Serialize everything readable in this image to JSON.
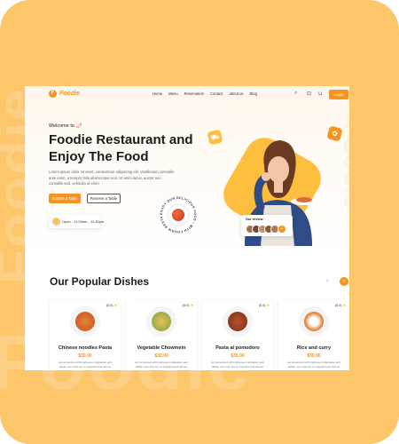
{
  "background": {
    "word_left": "Foodie",
    "word_bottom": "Foodie",
    "color": "#fdc66b"
  },
  "nav": {
    "logo": "Foodie",
    "links": [
      "Home",
      "Menu",
      "Reservation",
      "Contact",
      "about us",
      "Blog"
    ],
    "login_label": "Login",
    "accent": "#f7941d"
  },
  "hero": {
    "welcome": "Welcome to",
    "title": "Foodie Restaurant and Enjoy The Food",
    "description": "Lorem ipsum dolor sit amet, consectetur adipiscing elit. Vestibulum convallis ante enim, a tempor felis ullamcorper non. Ut enim lacus, auctor nec convallis sed, vehicula ut enim.",
    "btn_menu": "Explore a Table",
    "btn_reserve": "Reserve a Table",
    "hours": "Open : 11:00am - 11:30pm",
    "badge_text": "ENJOY OUR DELICIOUS FOOD • WITH FOODIE RESTAURANT •",
    "review_title": "Our review",
    "review_more": "+",
    "side_word": "Foodie"
  },
  "popular": {
    "title": "Our Popular Dishes",
    "prev": "‹",
    "next": "›",
    "dishes": [
      {
        "name": "Chinese noodles Pasta",
        "price": "$30.00",
        "rating": "(5.0)",
        "text": "we domecines with righteous indignation and dislike men who are so beguiled and demon"
      },
      {
        "name": "Vegetable Chowmein",
        "price": "$30.00",
        "rating": "(5.0)",
        "text": "we domecines with righteous indignation and dislike men who are so beguiled and demon"
      },
      {
        "name": "Pasta al pomodoro",
        "price": "$30.00",
        "rating": "(5.0)",
        "text": "we domecines with righteous indignation and dislike men who are so beguiled and demon"
      },
      {
        "name": "Rice and curry",
        "price": "$30.00",
        "rating": "(5.0)",
        "text": "we domecines with righteous indignation and dislike men who are so beguiled and demon"
      }
    ]
  }
}
